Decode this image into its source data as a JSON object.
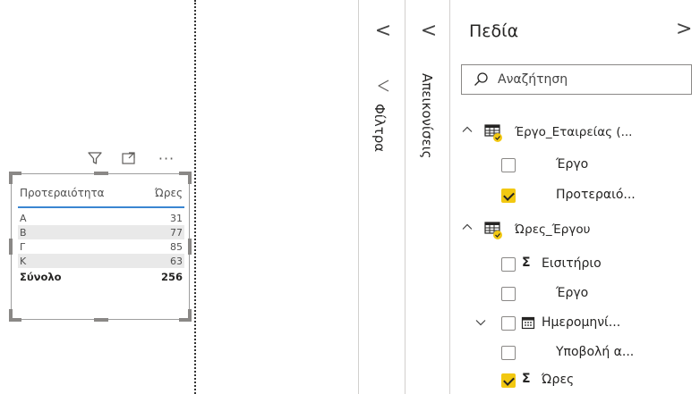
{
  "visual_header": {
    "filter_icon": "filter-icon",
    "focus_icon": "focus-mode-icon",
    "more_icon": "more-options-icon",
    "more_label": "···"
  },
  "table_visual": {
    "columns": [
      "Προτεραιότητα",
      "Ώρες"
    ],
    "rows": [
      {
        "priority": "A",
        "hours": "31"
      },
      {
        "priority": "B",
        "hours": "77"
      },
      {
        "priority": "Γ",
        "hours": "85"
      },
      {
        "priority": "K",
        "hours": "63"
      }
    ],
    "total_label": "Σύνολο",
    "total_value": "256"
  },
  "filters_pane": {
    "collapse_glyph": "<",
    "title": "Φίλτρα",
    "icon": "filter-pane-icon"
  },
  "visualizations_pane": {
    "collapse_glyph": "<",
    "title": "Απεικονίσεις"
  },
  "fields_pane": {
    "title": "Πεδία",
    "next_glyph": ">",
    "search_placeholder": "Αναζήτηση",
    "accent_color": "#f2c811",
    "tables": [
      {
        "name": "Έργο_Εταιρείας (...",
        "expanded": true,
        "fields": [
          {
            "label": "Έργο",
            "checked": false,
            "type": ""
          },
          {
            "label": "Προτεραιό...",
            "checked": true,
            "type": ""
          }
        ]
      },
      {
        "name": "Ώρες_Έργου",
        "expanded": true,
        "fields": [
          {
            "label": "Εισιτήριο",
            "checked": false,
            "type": "Σ"
          },
          {
            "label": "Έργο",
            "checked": false,
            "type": ""
          },
          {
            "label": "Ημερομηνί...",
            "checked": false,
            "type": "calendar",
            "collapsible": true
          },
          {
            "label": "Υποβολή α...",
            "checked": false,
            "type": ""
          },
          {
            "label": "Ώρες",
            "checked": true,
            "type": "Σ"
          }
        ]
      }
    ]
  }
}
